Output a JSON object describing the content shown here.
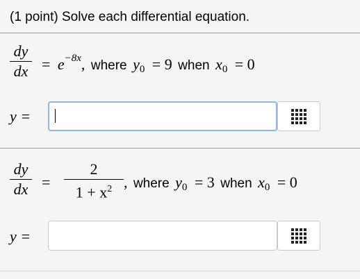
{
  "header": {
    "text": "(1 point) Solve each differential equation."
  },
  "problem1": {
    "lhs_num": "dy",
    "lhs_den": "dx",
    "equals": "=",
    "rhs_base": "e",
    "rhs_exp": "−8x",
    "comma": ",",
    "where_text": "where",
    "y0_var": "y",
    "y0_sub": "0",
    "y0_eq": "= 9",
    "when_text": "when",
    "x0_var": "x",
    "x0_sub": "0",
    "x0_eq": "= 0",
    "answer_label": "y =",
    "answer_value": ""
  },
  "problem2": {
    "lhs_num": "dy",
    "lhs_den": "dx",
    "equals": "=",
    "rhs_num": "2",
    "rhs_den_pre": "1 + x",
    "rhs_den_exp": "2",
    "comma": ",",
    "where_text": "where",
    "y0_var": "y",
    "y0_sub": "0",
    "y0_eq": "= 3",
    "when_text": "when",
    "x0_var": "x",
    "x0_sub": "0",
    "x0_eq": "= 0",
    "answer_label": "y =",
    "answer_value": ""
  },
  "icons": {
    "palette": "equation-palette-grid-icon"
  }
}
